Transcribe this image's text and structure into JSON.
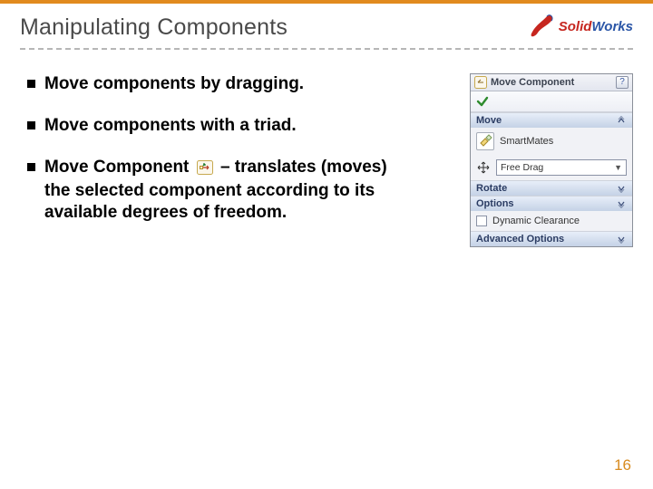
{
  "slide": {
    "title": "Manipulating Components",
    "page_number": "16"
  },
  "logo": {
    "solid": "Solid",
    "works": "Works"
  },
  "bullets": [
    {
      "text": "Move components by dragging."
    },
    {
      "text": "Move components with a triad."
    },
    {
      "lead": "Move Component ",
      "rest": " – translates (moves) the selected component according to its available degrees of freedom."
    }
  ],
  "panel": {
    "title": "Move Component",
    "help": "?",
    "sections": {
      "move": {
        "label": "Move",
        "smartmates_label": "SmartMates",
        "drag_mode": "Free Drag"
      },
      "rotate": {
        "label": "Rotate"
      },
      "options": {
        "label": "Options",
        "dynamic_clearance": "Dynamic Clearance"
      },
      "advanced": {
        "label": "Advanced Options"
      }
    }
  }
}
